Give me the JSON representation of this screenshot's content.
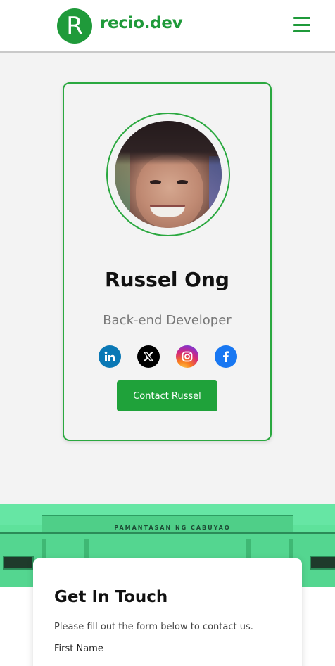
{
  "header": {
    "logo_letter": "R",
    "brand": "recio.dev",
    "menu_icon": "hamburger-menu-icon"
  },
  "profile": {
    "name": "Russel Ong",
    "role": "Back-end Developer",
    "contact_button": "Contact Russel",
    "socials": [
      {
        "icon": "linkedin-icon",
        "color": "#0a78b5"
      },
      {
        "icon": "x-twitter-icon",
        "color": "#000000"
      },
      {
        "icon": "instagram-icon",
        "color": "#d62976"
      },
      {
        "icon": "facebook-icon",
        "color": "#1877f2"
      }
    ]
  },
  "banner": {
    "sign_text": "PAMANTASAN NG CABUYAO"
  },
  "contact": {
    "title": "Get In Touch",
    "description": "Please fill out the form below to contact us.",
    "first_name_label": "First Name"
  },
  "colors": {
    "brand_green": "#1f9a3a",
    "card_border": "#2aa83f",
    "banner_green": "#5ee29b"
  }
}
